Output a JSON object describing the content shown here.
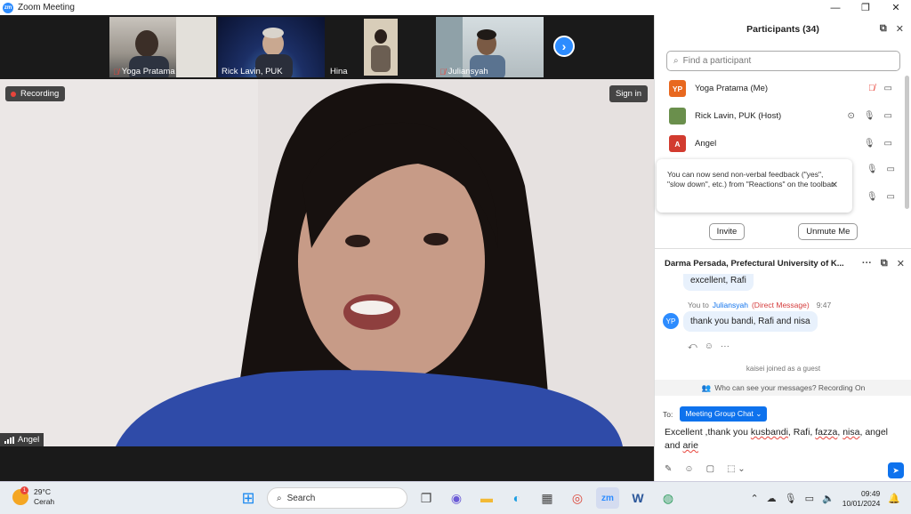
{
  "window": {
    "title": "Zoom Meeting",
    "logo": "zm",
    "controls": [
      "—",
      "❐",
      "✕"
    ]
  },
  "thumbnails": [
    {
      "name": "Yoga Pratama",
      "muted": true
    },
    {
      "name": "Rick Lavin, PUK",
      "muted": false
    },
    {
      "name": "Hina",
      "muted": false
    },
    {
      "name": "Juliansyah",
      "muted": true
    }
  ],
  "main_video": {
    "recording_label": "Recording",
    "signin_label": "Sign in",
    "speaker_name": "Angel"
  },
  "participants_panel": {
    "title": "Participants (34)",
    "search_placeholder": "Find a participant",
    "participants": [
      {
        "initials": "YP",
        "name": "Yoga Pratama (Me)",
        "avatar_color": "#e8681f",
        "mic": "muted",
        "video": "off"
      },
      {
        "initials": "",
        "name": "Rick Lavin, PUK (Host)",
        "avatar_color": "#6a8f4c",
        "mic": "on",
        "video": "off"
      },
      {
        "initials": "A",
        "name": "Angel",
        "avatar_color": "#d23b2f",
        "mic": "on",
        "video": "off"
      }
    ],
    "tooltip": "You can now send non-verbal feedback (\"yes\", \"slow down\", etc.) from \"Reactions\" on the toolbar.",
    "invite_label": "Invite",
    "unmute_label": "Unmute Me"
  },
  "chat": {
    "title": "Darma Persada, Prefectural University of K...",
    "prev_message": "excellent, Rafi",
    "message": {
      "avatar": "YP",
      "from": "You to",
      "to": "Juliansyah",
      "tag": "(Direct Message)",
      "time": "9:47",
      "text": "thank you bandi, Rafi and nisa"
    },
    "system_message": "kaisei joined as a guest",
    "privacy_text": "Who can see your messages? Recording On",
    "to_label": "To:",
    "recipient": "Meeting Group Chat",
    "compose_text": {
      "p1": "Excellent ,thank you ",
      "w1": "kusbandi",
      "p2": ", Rafi, ",
      "w2": "fazza",
      "p3": ", ",
      "w3": "nisa",
      "p4": ", angel and ",
      "w4": "arie"
    }
  },
  "taskbar": {
    "temperature": "29°C",
    "condition": "Cerah",
    "weather_badge": "1",
    "search_label": "Search",
    "time": "09:49",
    "date": "10/01/2024"
  }
}
